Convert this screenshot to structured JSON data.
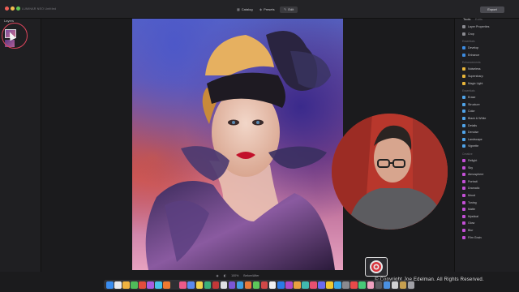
{
  "window": {
    "app_title": "LUMINAR NEO  Untitled",
    "traffic_lights": [
      "#ee5f57",
      "#f4bf4f",
      "#61c554"
    ]
  },
  "modes": [
    {
      "label": "Catalog",
      "icon": "catalog-icon"
    },
    {
      "label": "Presets",
      "icon": "presets-icon"
    },
    {
      "label": "Edit",
      "icon": "edit-icon",
      "active": true
    }
  ],
  "export_label": "Export",
  "left_panel": {
    "title": "Layers"
  },
  "right_panel": {
    "tabs": [
      {
        "label": "Tools",
        "active": true
      },
      {
        "label": "Edits",
        "active": false
      }
    ],
    "top_items": [
      {
        "label": "Layer Properties"
      },
      {
        "label": "Crop"
      }
    ],
    "sections": [
      {
        "title": "Essentials",
        "items": [
          "Develop",
          "Enhance"
        ]
      },
      {
        "title": "Enhancements",
        "items": [
          "Noiseless",
          "Supersharp",
          "Magic Light"
        ]
      },
      {
        "title": "Essentials",
        "items": [
          "Erase",
          "Structure",
          "Color",
          "Black & White",
          "Details",
          "Denoise",
          "Landscape",
          "Vignette"
        ]
      },
      {
        "title": "Creative",
        "items": [
          "Relight",
          "Sky",
          "Atmosphere",
          "Portrait",
          "Dramatic",
          "Mood",
          "Toning",
          "Matte",
          "Mystical",
          "Glow",
          "Blur",
          "Film Grain"
        ]
      }
    ],
    "item_colors": [
      "#3c8be0",
      "#3c8be0",
      "#e8b53a",
      "#e8b53a",
      "#e8b53a",
      "#4fa3e8",
      "#4fa3e8",
      "#4fa3e8",
      "#4fa3e8",
      "#4fa3e8",
      "#4fa3e8",
      "#4fa3e8",
      "#4fa3e8",
      "#c34fd6",
      "#c34fd6",
      "#c34fd6",
      "#c34fd6",
      "#c34fd6",
      "#c34fd6",
      "#c34fd6",
      "#c34fd6",
      "#c34fd6",
      "#c34fd6",
      "#c34fd6",
      "#c34fd6"
    ]
  },
  "bottom_bar": {
    "zoom": "100%",
    "view": "Before/After"
  },
  "overlay": {
    "copyright": "© Copyright Joe Edelman. All Rights Reserved."
  },
  "dock_colors": [
    "#3a8df0",
    "#e9e9ec",
    "#f0b240",
    "#4fbb5a",
    "#e24c3e",
    "#a85ce0",
    "#48c2e8",
    "#f07a30",
    "#2f2f33",
    "#ec5a8a",
    "#5a8af0",
    "#f2d24a",
    "#3ab07a",
    "#c23838",
    "#e0e0e4",
    "#7a56d6",
    "#40a0e0",
    "#e87a3a",
    "#5cc85a",
    "#d04848",
    "#f0f0f2",
    "#2a7ae8",
    "#b048c8",
    "#e8a040",
    "#40b8b0",
    "#e85070",
    "#6a6af0",
    "#f0c830",
    "#3aa8e8",
    "#8a8a90",
    "#e84a4a",
    "#48c878",
    "#f0a0c0",
    "#5a5a60",
    "#4a90e2",
    "#d0d0d4",
    "#c8a050",
    "#a0a0a6"
  ]
}
